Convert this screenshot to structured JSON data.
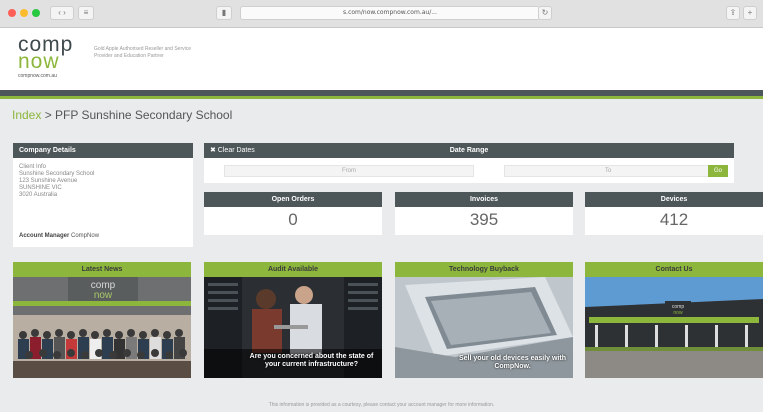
{
  "browser": {
    "url": "s.com/now.compnow.com.au/...",
    "tab_buttons": [
      "‹ ›",
      "≡",
      "▮"
    ]
  },
  "header": {
    "logo_top": "comp",
    "logo_bottom": "now",
    "logo_url": "compnow.com.au",
    "tagline": "Gold Apple Authorised Reseller and Service Provider and Education Partner"
  },
  "breadcrumb": {
    "link": "Index",
    "separator": " > ",
    "current": "PFP Sunshine Secondary School"
  },
  "company": {
    "title": "Company Details",
    "lines": [
      "Client Info",
      "Sunshine Secondary School",
      "123 Sunshine Avenue",
      "SUNSHINE VIC",
      "3020 Australia"
    ],
    "account_manager_label": "Account Manager",
    "account_manager_value": "CompNow"
  },
  "date_range": {
    "clear_label": "✖ Clear Dates",
    "title": "Date Range",
    "from_placeholder": "From",
    "to_placeholder": "To",
    "go_label": "Go"
  },
  "stats": [
    {
      "label": "Open Orders",
      "value": "0"
    },
    {
      "label": "Invoices",
      "value": "395"
    },
    {
      "label": "Devices",
      "value": "412"
    }
  ],
  "tiles": [
    {
      "title": "Latest News",
      "caption": ""
    },
    {
      "title": "Audit Available",
      "caption": "Are you concerned about the state of your current infrastructure?"
    },
    {
      "title": "Technology Buyback",
      "caption": "Sell your old devices easily with CompNow."
    },
    {
      "title": "Contact Us",
      "caption": ""
    }
  ],
  "footer": {
    "text": "This information is provided as a courtesy, please contact your account manager for more information."
  },
  "colors": {
    "accent_green": "#8cb63c",
    "header_dark": "#4d5658"
  }
}
